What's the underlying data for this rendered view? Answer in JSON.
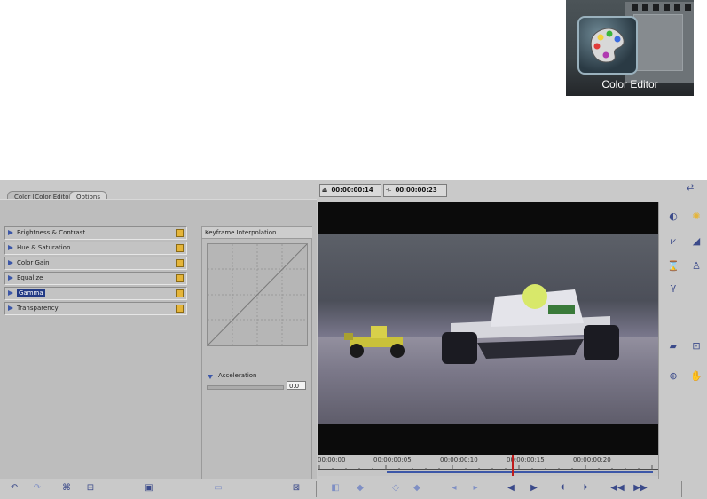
{
  "tile": {
    "label": "Color Editor",
    "icon": "palette-icon"
  },
  "tabs": [
    {
      "label": "Color [Color Editor]",
      "active": true
    },
    {
      "label": "Options",
      "active": false
    }
  ],
  "effects": [
    {
      "label": "Brightness & Contrast",
      "selected": false
    },
    {
      "label": "Hue & Saturation",
      "selected": false
    },
    {
      "label": "Color Gain",
      "selected": false
    },
    {
      "label": "Equalize",
      "selected": false
    },
    {
      "label": "Gamma",
      "selected": true
    },
    {
      "label": "Transparency",
      "selected": false
    }
  ],
  "keyframe": {
    "title": "Keyframe Interpolation",
    "acceleration_label": "Acceleration",
    "acceleration_value": "0.0"
  },
  "timecodes": {
    "current": "00:00:00:14",
    "duration": "00:00:00:23"
  },
  "timeline": {
    "labels": [
      "00:00:00",
      "00:00:00:05",
      "00:00:00:10",
      "00:00:00:15",
      "00:00:00:20"
    ],
    "playhead_fraction": 0.57
  },
  "icons": {
    "right_tools": [
      "contrast-icon",
      "sun-icon",
      "gain-icon",
      "wedge-icon",
      "timer-icon",
      "person-icon",
      "gamma-icon",
      "video-icon",
      "fit-icon",
      "zoom-icon",
      "hand-icon"
    ],
    "bottom_tools": [
      "undo-icon",
      "redo-icon",
      "link-icon",
      "fit-window-icon",
      "monitor-icon",
      "ruler-icon",
      "save-icon",
      "keyframe-add-icon",
      "keyframe-prev-icon",
      "keyframe-next-icon",
      "keyframe-del-icon",
      "nav-prev-icon",
      "nav-next-icon",
      "step-back-icon",
      "step-forward-icon",
      "play-back-icon",
      "play-forward-icon",
      "rewind-icon",
      "fast-forward-icon"
    ]
  },
  "colors": {
    "accent": "#3c57a8",
    "selection": "#223a85",
    "keyframe": "#e5b53a",
    "playhead": "#c01c1c"
  }
}
